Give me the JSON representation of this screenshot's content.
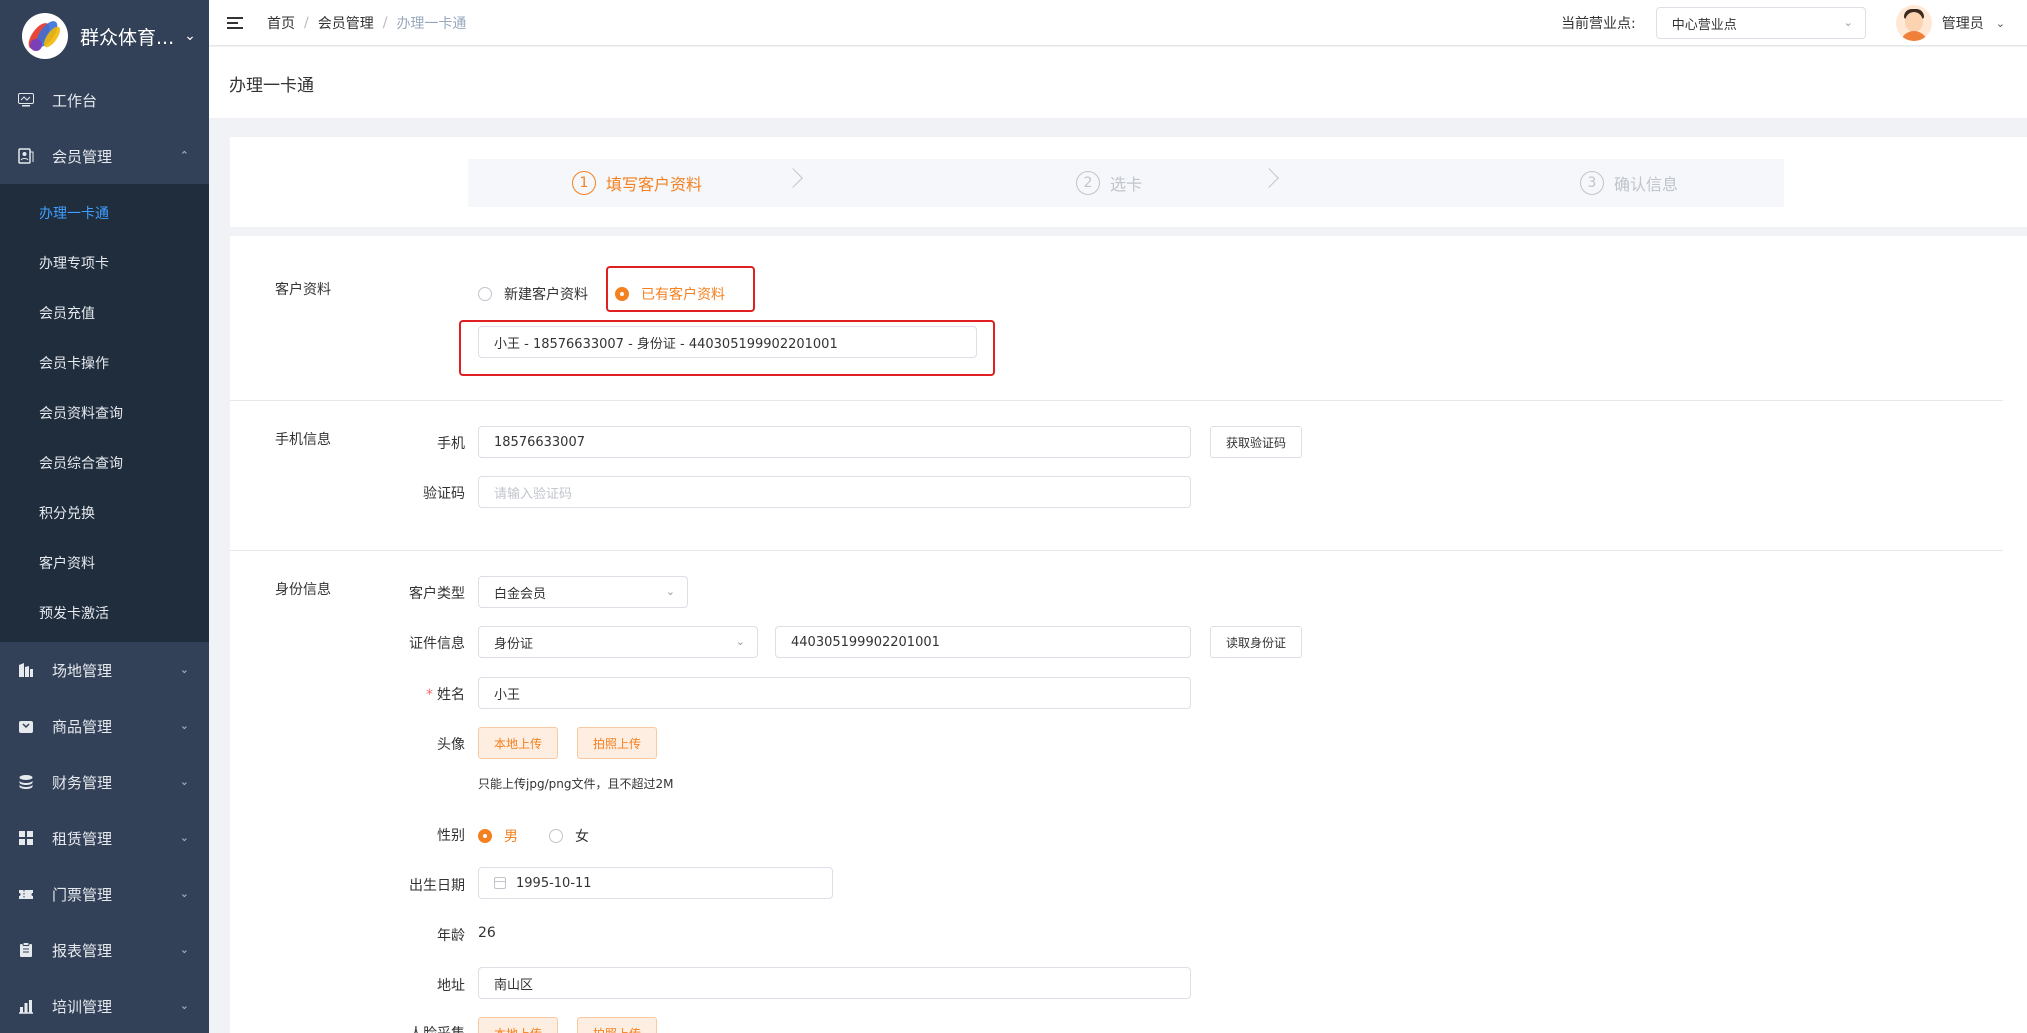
{
  "sidebar": {
    "brand": "群众体育...",
    "menu": [
      {
        "label": "工作台",
        "icon": "monitor-icon"
      },
      {
        "label": "会员管理",
        "icon": "member-icon"
      }
    ],
    "member_sub": [
      "办理一卡通",
      "办理专项卡",
      "会员充值",
      "会员卡操作",
      "会员资料查询",
      "会员综合查询",
      "积分兑换",
      "客户资料",
      "预发卡激活"
    ],
    "menu_after": [
      {
        "label": "场地管理",
        "icon": "venue-icon"
      },
      {
        "label": "商品管理",
        "icon": "goods-icon"
      },
      {
        "label": "财务管理",
        "icon": "finance-icon"
      },
      {
        "label": "租赁管理",
        "icon": "lease-icon"
      },
      {
        "label": "门票管理",
        "icon": "ticket-icon"
      },
      {
        "label": "报表管理",
        "icon": "report-icon"
      },
      {
        "label": "培训管理",
        "icon": "training-icon"
      }
    ]
  },
  "header": {
    "breadcrumb": [
      "首页",
      "会员管理",
      "办理一卡通"
    ],
    "store_label": "当前营业点:",
    "store_value": "中心营业点",
    "admin": "管理员"
  },
  "page": {
    "title": "办理一卡通"
  },
  "steps": [
    {
      "num": "1",
      "label": "填写客户资料"
    },
    {
      "num": "2",
      "label": "选卡"
    },
    {
      "num": "3",
      "label": "确认信息"
    }
  ],
  "form": {
    "customer": {
      "section": "客户资料",
      "radio_new": "新建客户资料",
      "radio_existing": "已有客户资料",
      "existing_value": "小王 - 18576633007 - 身份证 - 440305199902201001"
    },
    "phone": {
      "section": "手机信息",
      "phone_label": "手机",
      "phone_value": "18576633007",
      "get_code": "获取验证码",
      "code_label": "验证码",
      "code_placeholder": "请输入验证码"
    },
    "identity": {
      "section": "身份信息",
      "type_label": "客户类型",
      "type_value": "白金会员",
      "id_label": "证件信息",
      "id_type": "身份证",
      "id_number": "440305199902201001",
      "read_id": "读取身份证",
      "name_label": "姓名",
      "name_value": "小王",
      "avatar_label": "头像",
      "local_upload": "本地上传",
      "photo_upload": "拍照上传",
      "upload_hint": "只能上传jpg/png文件，且不超过2M",
      "gender_label": "性别",
      "gender_male": "男",
      "gender_female": "女",
      "birth_label": "出生日期",
      "birth_value": "1995-10-11",
      "age_label": "年龄",
      "age_value": "26",
      "address_label": "地址",
      "address_value": "南山区",
      "face_label": "人脸采集",
      "face_local": "本地上传",
      "face_photo": "拍照上传"
    }
  },
  "colors": {
    "accent": "#f5801f",
    "sidebar": "#324157",
    "submenu": "#1f2d3d",
    "highlight": "#e02020",
    "link": "#409eff"
  }
}
